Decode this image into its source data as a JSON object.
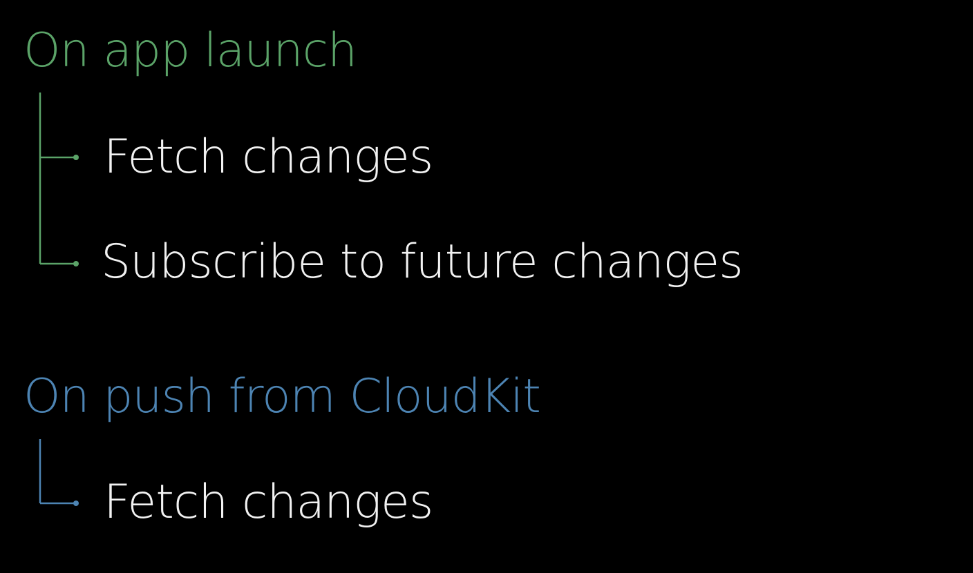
{
  "colors": {
    "background": "#000000",
    "group1_accent": "#5ba368",
    "group2_accent": "#4d84b3",
    "item_text": "#f2f2f2"
  },
  "groups": [
    {
      "heading": "On app launch",
      "items": [
        {
          "label": "Fetch changes"
        },
        {
          "label": "Subscribe to future changes"
        }
      ]
    },
    {
      "heading": "On push from CloudKit",
      "items": [
        {
          "label": "Fetch changes"
        }
      ]
    }
  ]
}
